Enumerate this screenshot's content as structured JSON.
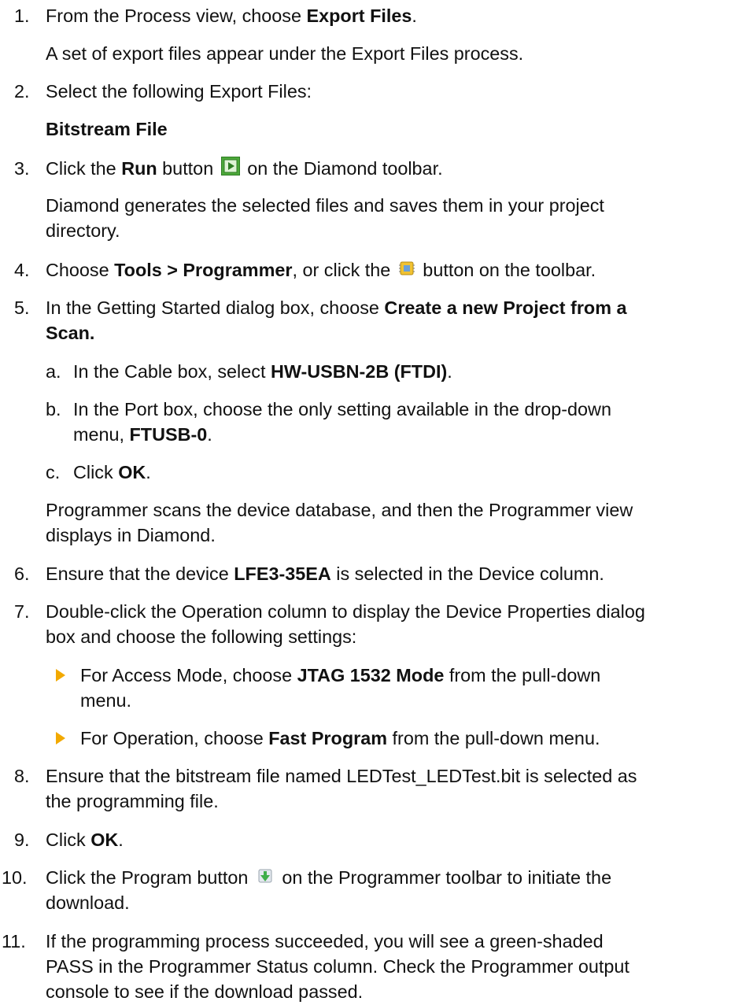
{
  "steps": {
    "s1": {
      "num": "1.",
      "pre": "From the Process view, choose ",
      "b1": "Export Files",
      "post": ".",
      "result": "A set of export files appear under the Export Files process."
    },
    "s2": {
      "num": "2.",
      "text": "Select the following Export Files:",
      "item": "Bitstream File"
    },
    "s3": {
      "num": "3.",
      "pre": "Click the ",
      "b1": "Run",
      "mid": " button ",
      "post": " on the Diamond toolbar.",
      "result_1": "Diamond generates the selected files and saves them in your project",
      "result_2": "directory."
    },
    "s4": {
      "num": "4.",
      "pre": "Choose ",
      "b1": "Tools > Programmer",
      "mid": ", or click the ",
      "post": " button on the toolbar."
    },
    "s5": {
      "num": "5.",
      "pre": "In the Getting Started dialog box, choose ",
      "b1": "Create a new Project from a",
      "b2": "Scan.",
      "a": {
        "num": "a.",
        "pre": "In the Cable box, select ",
        "b1": "HW-USBN-2B (FTDI)",
        "post": "."
      },
      "b": {
        "num": "b.",
        "line1": "In the Port box, choose the only setting available in the drop-down",
        "pre": "menu, ",
        "b1": "FTUSB-0",
        "post": "."
      },
      "c": {
        "num": "c.",
        "pre": "Click ",
        "b1": "OK",
        "post": "."
      },
      "result_1": "Programmer scans the device database, and then the Programmer view",
      "result_2": "displays in Diamond."
    },
    "s6": {
      "num": "6.",
      "pre": "Ensure that the device ",
      "b1": "LFE3-35EA",
      "post": " is selected in the Device column."
    },
    "s7": {
      "num": "7.",
      "line1": "Double-click the Operation column to display the Device Properties dialog",
      "line2": "box and choose the following settings:",
      "bullet1": {
        "pre": "For Access Mode, choose ",
        "b1": "JTAG 1532 Mode",
        "post": " from the pull-down",
        "line2": "menu."
      },
      "bullet2": {
        "pre": "For Operation, choose ",
        "b1": "Fast Program",
        "post": " from the pull-down menu."
      }
    },
    "s8": {
      "num": "8.",
      "line1": "Ensure that the bitstream file named LEDTest_LEDTest.bit is selected as",
      "line2": "the programming file."
    },
    "s9": {
      "num": "9.",
      "pre": "Click ",
      "b1": "OK",
      "post": "."
    },
    "s10": {
      "num": "10.",
      "pre": "Click the Program button ",
      "post": " on the Programmer toolbar to initiate the",
      "line2": "download."
    },
    "s11": {
      "num": "11.",
      "line1": "If the programming process succeeded, you will see a green-shaded",
      "line2": "PASS in the Programmer Status column. Check the Programmer output",
      "line3": "console to see if the download passed."
    }
  },
  "icons": {
    "run": "run-button-icon",
    "programmer": "programmer-chip-icon",
    "program": "program-download-icon"
  },
  "colors": {
    "bullet_arrow": "#f2a900",
    "text": "#111111"
  }
}
